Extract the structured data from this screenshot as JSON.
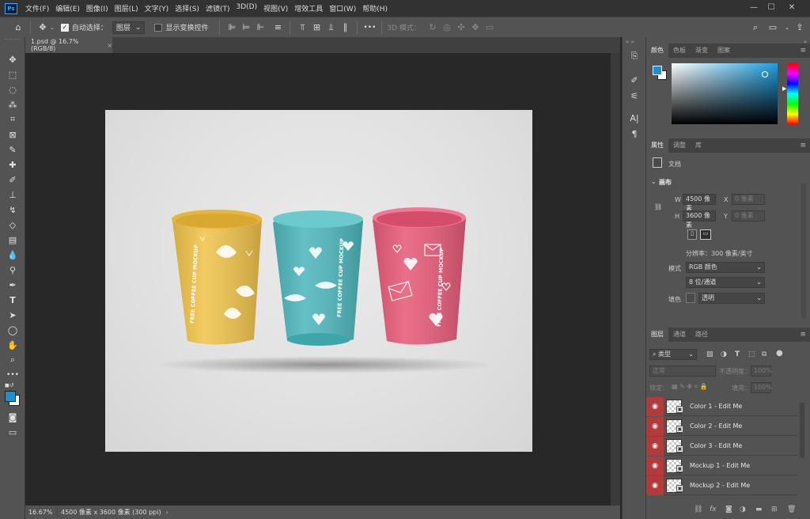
{
  "app": {
    "logo": "Ps"
  },
  "menu": [
    "文件(F)",
    "编辑(E)",
    "图像(I)",
    "图层(L)",
    "文字(Y)",
    "选择(S)",
    "滤镜(T)",
    "3D(D)",
    "视图(V)",
    "增效工具",
    "窗口(W)",
    "帮助(H)"
  ],
  "window_controls": {
    "minimize": "—",
    "maximize": "☐",
    "close": "✕"
  },
  "options": {
    "auto_select_label": "自动选择：",
    "auto_select_target": "图层",
    "show_transform_label": "显示变换控件",
    "mode_3d_label": "3D 模式：",
    "more": "•••"
  },
  "document": {
    "tab_title": "1.psd @ 16.7%(RGB/8)",
    "tab_close": "×"
  },
  "status": {
    "zoom": "16.67%",
    "info": "4500 像素 x 3600 像素 (300 ppi)",
    "arrow": "›"
  },
  "color_panel": {
    "tabs": [
      "颜色",
      "色板",
      "渐变",
      "图案"
    ],
    "foreground": "#1e90d0",
    "background": "#ffffff"
  },
  "properties_panel": {
    "tabs": [
      "属性",
      "调整",
      "库"
    ],
    "doc_label": "文档",
    "section_canvas": "画布",
    "w_label": "W",
    "w_value": "4500 像素",
    "h_label": "H",
    "h_value": "3600 像素",
    "x_label": "X",
    "x_value": "0 像素",
    "y_label": "Y",
    "y_value": "0 像素",
    "resolution": "分辨率：300 像素/英寸",
    "mode_label": "模式",
    "mode_value": "RGB 颜色",
    "depth_value": "8 位/通道",
    "fill_label": "填色",
    "fill_value": "透明"
  },
  "layers_panel": {
    "tabs": [
      "图层",
      "通道",
      "路径"
    ],
    "filter_kind": "类型",
    "blend_mode": "正常",
    "opacity_label": "不透明度：",
    "opacity_value": "100%",
    "lock_label": "锁定：",
    "fill_label": "填充：",
    "fill_value": "100%",
    "layers": [
      {
        "name": "Color 1 - Edit Me"
      },
      {
        "name": "Color 2 - Edit Me"
      },
      {
        "name": "Color 3 - Edit Me"
      },
      {
        "name": "Mockup 1 - Edit Me"
      },
      {
        "name": "Mockup 2 - Edit Me"
      }
    ]
  },
  "mockup": {
    "cup_text": "FREE COFFEE CUP MOCKUP",
    "cups": [
      {
        "color": "#f0c44c"
      },
      {
        "color": "#4fb8bd"
      },
      {
        "color": "#e85c7a"
      }
    ]
  }
}
